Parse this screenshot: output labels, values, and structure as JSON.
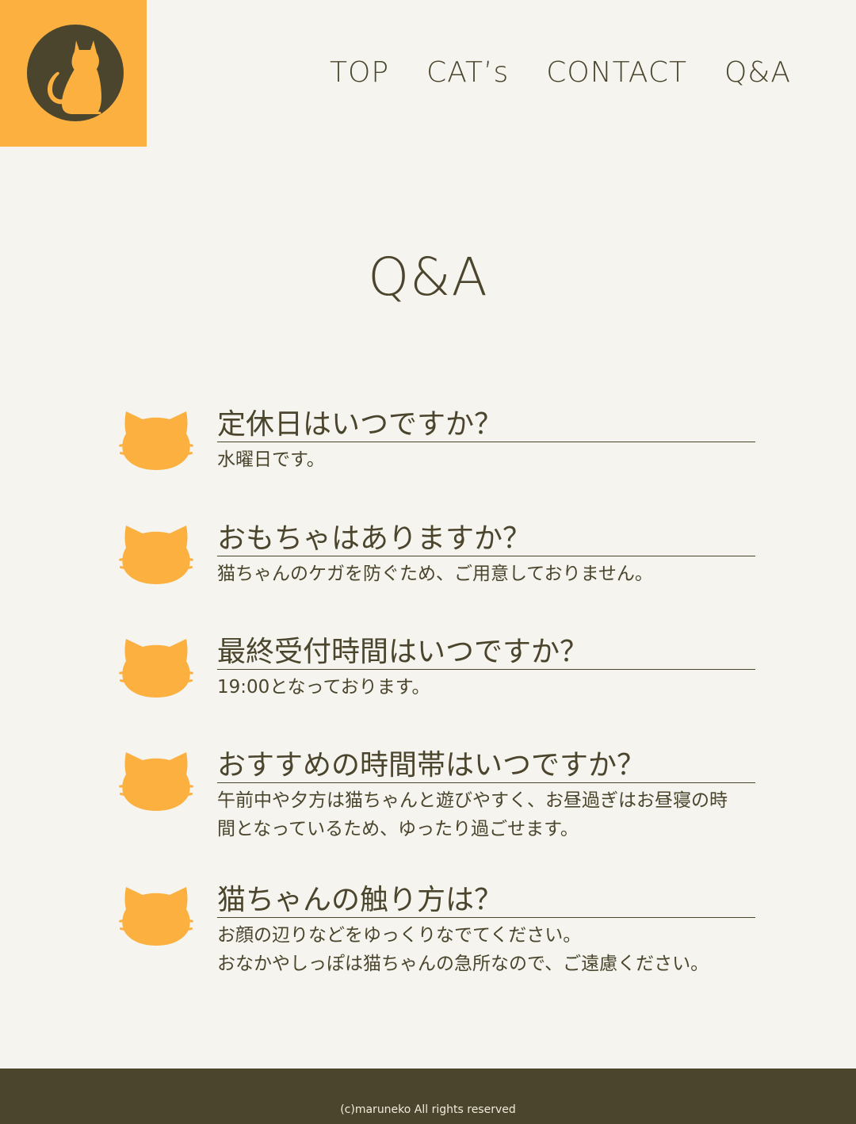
{
  "header": {
    "logo_icon": "cat-silhouette-icon",
    "nav": [
      {
        "label": "TOP"
      },
      {
        "label": "CAT’s"
      },
      {
        "label": "CONTACT"
      },
      {
        "label": "Q&A"
      }
    ]
  },
  "main": {
    "title": "Q&A",
    "faq": [
      {
        "question": "定休日はいつですか？",
        "answer_lines": [
          "水曜日です。"
        ]
      },
      {
        "question": "おもちゃはありますか？",
        "answer_lines": [
          "猫ちゃんのケガを防ぐため、ご用意しておりません。"
        ]
      },
      {
        "question": "最終受付時間はいつですか？",
        "answer_lines": [
          "19:00となっております。"
        ]
      },
      {
        "question": "おすすめの時間帯はいつですか？",
        "answer_lines": [
          "午前中や夕方は猫ちゃんと遊びやすく、お昼過ぎはお昼寝の時",
          "間となっているため、ゆったり過ごせます。"
        ]
      },
      {
        "question": "猫ちゃんの触り方は？",
        "answer_lines": [
          "お顔の辺りなどをゆっくりなでてください。",
          "おなかやしっぽは猫ちゃんの急所なので、ご遠慮ください。"
        ]
      }
    ],
    "faq_icon": "cat-face-icon"
  },
  "footer": {
    "copyright": "(c)maruneko All rights reserved"
  },
  "colors": {
    "background": "#f5f4ef",
    "accent": "#fbb040",
    "text": "#4a452c",
    "footer_bg": "#4a452c"
  }
}
